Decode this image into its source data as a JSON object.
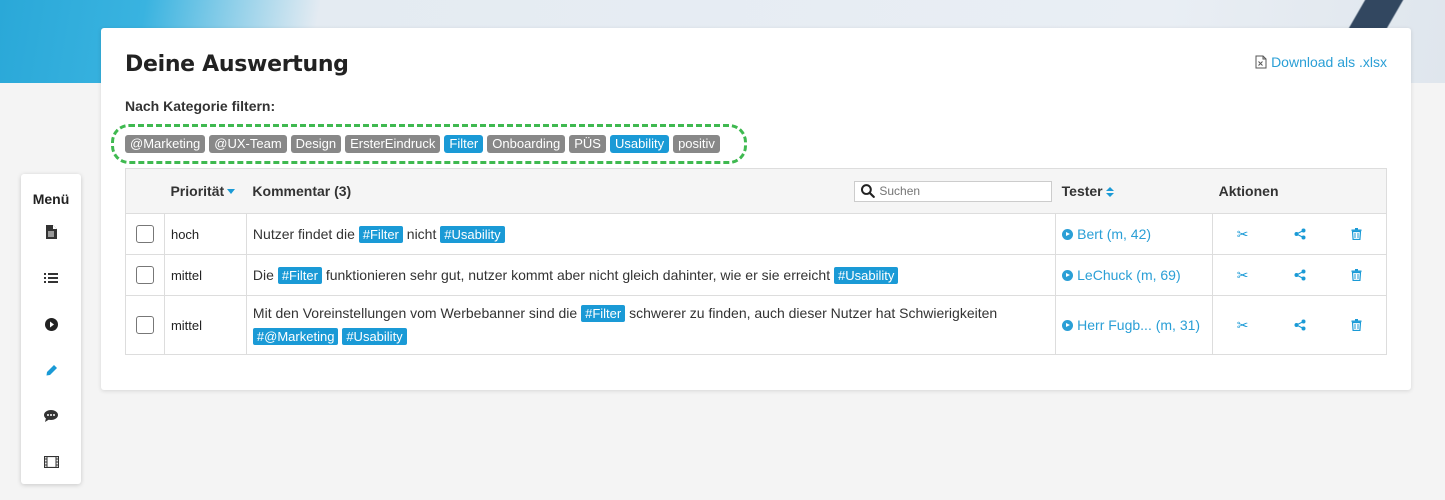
{
  "page": {
    "title": "Deine Auswertung",
    "download_label": "Download als .xlsx"
  },
  "filter": {
    "label": "Nach Kategorie filtern:",
    "tags": [
      {
        "label": "@Marketing",
        "active": false
      },
      {
        "label": "@UX-Team",
        "active": false
      },
      {
        "label": "Design",
        "active": false
      },
      {
        "label": "ErsterEindruck",
        "active": false
      },
      {
        "label": "Filter",
        "active": true
      },
      {
        "label": "Onboarding",
        "active": false
      },
      {
        "label": "PÜS",
        "active": false
      },
      {
        "label": "Usability",
        "active": true
      },
      {
        "label": "positiv",
        "active": false
      }
    ]
  },
  "table": {
    "headers": {
      "priority": "Priorität",
      "comment": "Kommentar (3)",
      "tester": "Tester",
      "actions": "Aktionen"
    },
    "search_placeholder": "Suchen",
    "rows": [
      {
        "priority": "hoch",
        "comment_parts": [
          "Nutzer findet die",
          "#Filter",
          "nicht",
          "#Usability"
        ],
        "tester": "Bert (m, 42)"
      },
      {
        "priority": "mittel",
        "comment_parts": [
          "Die",
          "#Filter",
          "funktionieren sehr gut, nutzer kommt aber nicht gleich dahinter, wie er sie erreicht",
          "#Usability"
        ],
        "tester": "LeChuck (m, 69)"
      },
      {
        "priority": "mittel",
        "comment_parts": [
          "Mit den Voreinstellungen vom Werbebanner sind die",
          "#Filter",
          "schwerer zu finden, auch dieser Nutzer hat Schwierigkeiten",
          "#@Marketing",
          "#Usability"
        ],
        "tester": "Herr Fugb... (m, 31)"
      }
    ]
  },
  "menu": {
    "title": "Menü",
    "items": [
      "document-icon",
      "list-icon",
      "play-icon",
      "pencil-icon",
      "comment-icon",
      "film-icon"
    ],
    "active_item": "pencil-icon"
  },
  "colors": {
    "accent": "#1a9ad6",
    "tag_inactive": "#888888",
    "highlight": "#3fb950"
  }
}
